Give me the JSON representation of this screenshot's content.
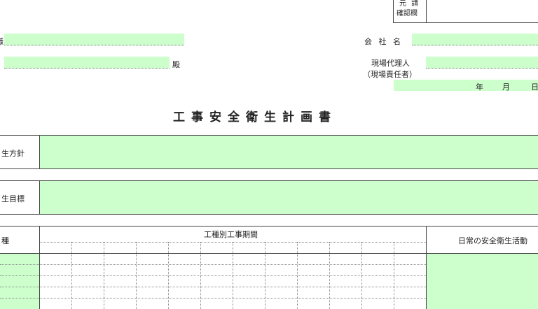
{
  "confirm_box": {
    "line1": "元 請",
    "line2": "確認欄"
  },
  "header": {
    "partial_left_1": "様",
    "addressee_suffix": "殿",
    "company_label": "会 社 名",
    "agent_label": "現場代理人",
    "agent_sub_label": "（現場責任者）",
    "date_year": "年",
    "date_month": "月",
    "date_day": "日"
  },
  "title": "工事安全衛生計画書",
  "sections": {
    "policy_label": "生方針",
    "target_label": "生目標"
  },
  "schedule_table": {
    "left_header": "種",
    "period_header": "工種別工事期間",
    "activity_header": "日常の安全衛生活動"
  }
}
